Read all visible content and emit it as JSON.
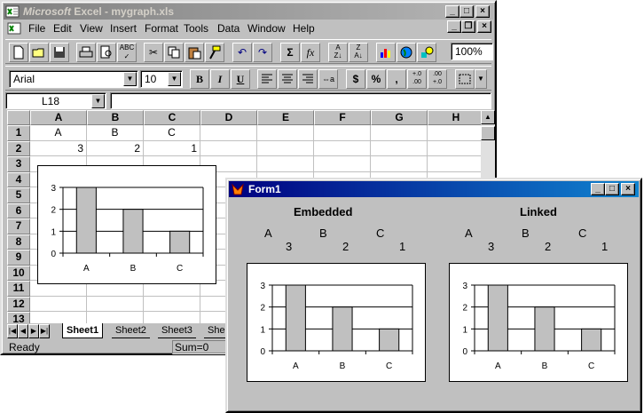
{
  "excel": {
    "title_logo": "Microsoft",
    "title": "Excel - mygraph.xls",
    "menu": [
      "File",
      "Edit",
      "View",
      "Insert",
      "Format",
      "Tools",
      "Data",
      "Window",
      "Help"
    ],
    "menu_underline": [
      "F",
      "E",
      "V",
      "I",
      "o",
      "T",
      "D",
      "W",
      "H"
    ],
    "zoom": "100%",
    "font_name": "Arial",
    "font_size": "10",
    "name_box": "L18",
    "columns": [
      "A",
      "B",
      "C",
      "D",
      "E",
      "F",
      "G",
      "H"
    ],
    "rows": [
      "1",
      "2",
      "3",
      "4",
      "5",
      "6",
      "7",
      "8",
      "9",
      "10",
      "11",
      "12",
      "13"
    ],
    "cells": {
      "A1": "A",
      "B1": "B",
      "C1": "C",
      "A2": "3",
      "B2": "2",
      "C2": "1"
    },
    "sheet_tabs": [
      "Sheet1",
      "Sheet2",
      "Sheet3",
      "Shee"
    ],
    "status": "Ready",
    "sum": "Sum=0"
  },
  "form1": {
    "title": "Form1",
    "embedded": {
      "heading": "Embedded",
      "labels": [
        "A",
        "B",
        "C"
      ],
      "values": [
        "3",
        "2",
        "1"
      ]
    },
    "linked": {
      "heading": "Linked",
      "labels": [
        "A",
        "B",
        "C"
      ],
      "values": [
        "3",
        "2",
        "1"
      ]
    }
  },
  "chart_data": [
    {
      "type": "bar",
      "categories": [
        "A",
        "B",
        "C"
      ],
      "values": [
        3,
        2,
        1
      ],
      "ylim": [
        0,
        3
      ],
      "yticks": [
        0,
        1,
        2,
        3
      ],
      "grid": true,
      "bar_color": "#c0c0c0"
    },
    {
      "type": "bar",
      "categories": [
        "A",
        "B",
        "C"
      ],
      "values": [
        3,
        2,
        1
      ],
      "ylim": [
        0,
        3
      ],
      "yticks": [
        0,
        1,
        2,
        3
      ],
      "grid": true,
      "bar_color": "#c0c0c0"
    },
    {
      "type": "bar",
      "categories": [
        "A",
        "B",
        "C"
      ],
      "values": [
        3,
        2,
        1
      ],
      "ylim": [
        0,
        3
      ],
      "yticks": [
        0,
        1,
        2,
        3
      ],
      "grid": true,
      "bar_color": "#c0c0c0"
    }
  ]
}
